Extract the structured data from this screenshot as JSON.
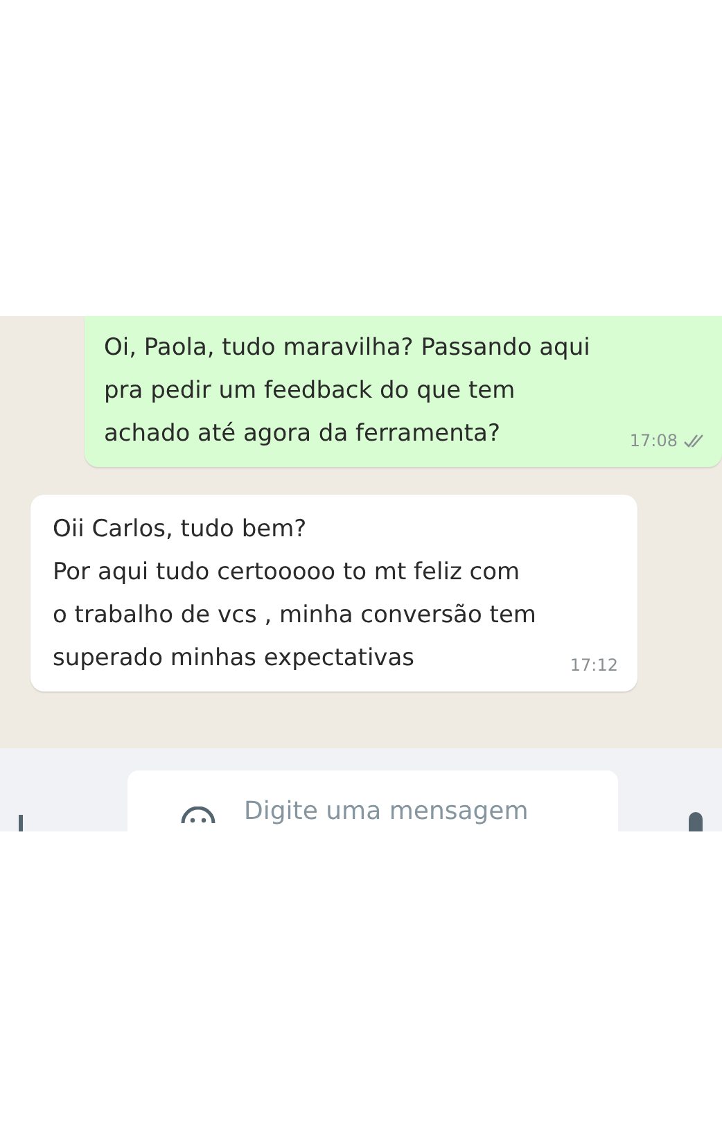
{
  "messages": [
    {
      "kind": "outgoing",
      "lines": [
        "Oi, Paola, tudo maravilha? Passando aqui",
        "pra pedir um feedback do que tem",
        "achado até agora da ferramenta?"
      ],
      "time": "17:08",
      "read": false
    },
    {
      "kind": "incoming",
      "lines": [
        "Oii Carlos, tudo bem?",
        "Por aqui tudo certooooo to mt feliz com",
        "o trabalho de vcs , minha conversão tem",
        "superado minhas expectativas"
      ],
      "time": "17:12"
    }
  ],
  "composer": {
    "placeholder": "Digite uma mensagem"
  }
}
